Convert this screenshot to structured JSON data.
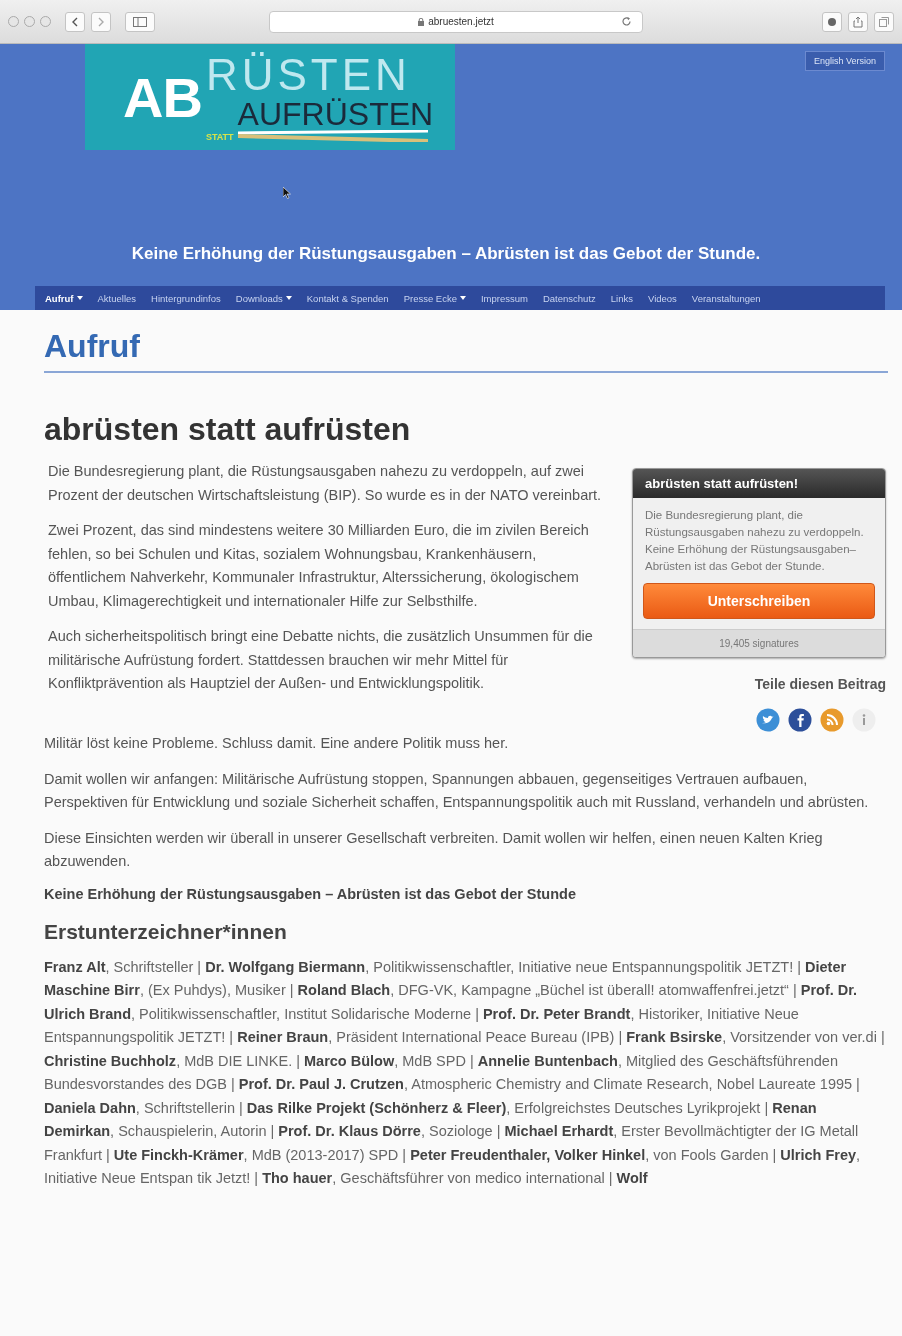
{
  "browser": {
    "address": "abruesten.jetzt"
  },
  "header": {
    "logo": {
      "ab": "AB",
      "rusten": "RÜSTEN",
      "statt": "STATT",
      "aufrusten": "AUFRÜSTEN"
    },
    "language_button": "English Version",
    "tagline": "Keine Erhöhung der Rüstungsausgaben – Abrüsten ist das Gebot der Stunde."
  },
  "nav": [
    {
      "label": "Aufruf",
      "selected": true,
      "dropdown": true
    },
    {
      "label": "Aktuelles",
      "selected": false,
      "dropdown": false
    },
    {
      "label": "Hintergrundinfos",
      "selected": false,
      "dropdown": false
    },
    {
      "label": "Downloads",
      "selected": false,
      "dropdown": true
    },
    {
      "label": "Kontakt & Spenden",
      "selected": false,
      "dropdown": false
    },
    {
      "label": "Presse Ecke",
      "selected": false,
      "dropdown": true
    },
    {
      "label": "Impressum",
      "selected": false,
      "dropdown": false
    },
    {
      "label": "Datenschutz",
      "selected": false,
      "dropdown": false
    },
    {
      "label": "Links",
      "selected": false,
      "dropdown": false
    },
    {
      "label": "Videos",
      "selected": false,
      "dropdown": false
    },
    {
      "label": "Veranstaltungen",
      "selected": false,
      "dropdown": false
    }
  ],
  "page_title": "Aufruf",
  "article": {
    "title": "abrüsten statt aufrüsten",
    "intro": [
      "Die Bundesregierung plant, die Rüstungsausgaben nahezu zu verdoppeln, auf zwei Prozent der deutschen Wirtschaftsleistung (BIP). So wurde es in der NATO vereinbart.",
      "Zwei Prozent, das sind mindestens weitere 30 Milliarden Euro, die im zivilen Bereich fehlen, so bei Schulen und Kitas, sozialem Wohnungsbau, Krankenhäusern, öffentlichem Nahverkehr, Kommunaler Infrastruktur, Alterssicherung, ökologischem Umbau, Klimagerechtigkeit und internationaler Hilfe zur Selbsthilfe.",
      "Auch sicherheitspolitisch bringt eine Debatte nichts, die zusätzlich Unsummen für die militärische Aufrüstung fordert. Stattdessen brauchen wir mehr Mittel für Konfliktprävention als Hauptziel der Außen- und Entwicklungspolitik."
    ],
    "body": [
      "Militär löst keine Probleme. Schluss damit. Eine andere Politik muss her.",
      "Damit wollen wir anfangen: Militärische Aufrüstung stoppen, Spannungen abbauen, gegenseitiges Vertrauen aufbauen, Perspektiven für Entwicklung und soziale Sicherheit schaffen, Entspannungspolitik auch mit Russland, verhandeln und abrüsten.",
      "Diese Einsichten werden wir überall in unserer Gesellschaft verbreiten. Damit wollen wir helfen, einen neuen Kalten Krieg abzuwenden."
    ],
    "slogan": "Keine Erhöhung der Rüstungsausgaben – Abrüsten ist das Gebot der Stunde",
    "signatories_heading": "Erstunterzeichner*innen",
    "signatories": "**Franz Alt**, Schriftsteller | **Dr. Wolfgang Biermann**, Politikwissenschaftler, Initiative neue Entspannungspolitik JETZT! | **Dieter Maschine Birr**, (Ex Puhdys), Musiker | **Roland Blach**, DFG-VK, Kampagne „Büchel ist überall! atomwaffenfrei.jetzt“ | **Prof. Dr. Ulrich Brand**, Politikwissenschaftler, Institut Solidarische Moderne | **Prof. Dr. Peter Brandt**, Historiker, Initiative Neue Entspannungspolitik JETZT! | **Reiner Braun**, Präsident International Peace Bureau (IPB) | **Frank Bsirske**, Vorsitzender von ver.di | **Christine Buchholz**, MdB DIE LINKE. | **Marco Bülow**, MdB SPD | **Annelie Buntenbach**, Mitglied des Geschäftsführenden Bundesvorstandes des DGB | **Prof. Dr. Paul J. Crutzen**, Atmospheric Chemistry and Climate Research, Nobel Laureate 1995 | **Daniela Dahn**, Schriftstellerin | **Das Rilke Projekt (Schönherz & Fleer)**, Erfolgreichstes Deutsches Lyrikprojekt | **Renan Demirkan**, Schauspielerin, Autorin | **Prof. Dr. Klaus Dörre**, Soziologe | **Michael Erhardt**, Erster Bevollmächtigter der IG Metall Frankfurt | **Ute Finckh-Krämer**, MdB (2013-2017) SPD | **Peter Freudenthaler, Volker Hinkel**, von Fools Garden | **Ulrich Frey**, Initiative Neue Entspan tik Jetzt! | **Tho hauer**, Geschäftsführer von medico international | **Wolf**"
  },
  "sign_box": {
    "title": "abrüsten statt aufrüsten!",
    "text": "Die Bundesregierung plant, die Rüstungsausgaben nahezu zu verdoppeln. Keine Erhöhung der Rüstungsausgaben–Abrüsten ist das Gebot der Stunde.",
    "button": "Unterschreiben",
    "count": "19,405 signatures"
  },
  "share": {
    "title": "Teile diesen Beitrag",
    "icons": [
      {
        "kind": "twitter",
        "color": "#3d8fd6"
      },
      {
        "kind": "facebook",
        "color": "#2d4f9a"
      },
      {
        "kind": "rss",
        "color": "#e89a2c"
      },
      {
        "kind": "info",
        "color": "#eeeeee"
      }
    ]
  }
}
